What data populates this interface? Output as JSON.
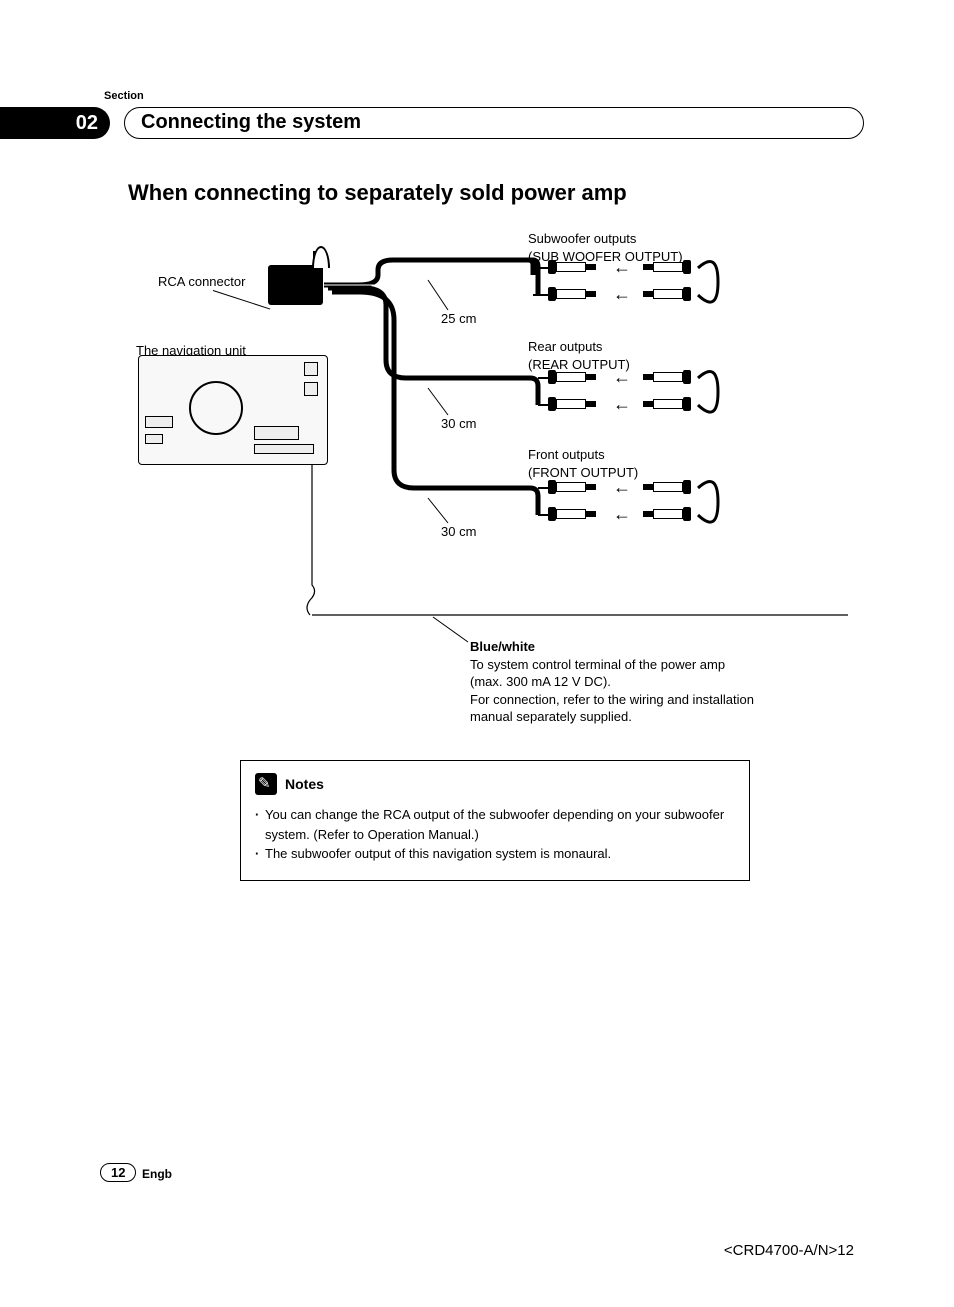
{
  "header": {
    "section_label": "Section",
    "section_number": "02",
    "chapter_title": "Connecting the system"
  },
  "main_title": "When connecting to separately sold power amp",
  "diagram": {
    "rca_connector_label": "RCA connector",
    "nav_unit_label": "The navigation unit",
    "outputs": {
      "subwoofer": {
        "title": "Subwoofer outputs",
        "subtitle": "(SUB WOOFER OUTPUT)",
        "length": "25 cm"
      },
      "rear": {
        "title": "Rear outputs",
        "subtitle": "(REAR OUTPUT)",
        "length": "30 cm"
      },
      "front": {
        "title": "Front outputs",
        "subtitle": "(FRONT OUTPUT)",
        "length": "30 cm"
      }
    },
    "blue_white": {
      "heading": "Blue/white",
      "line1": "To system control terminal of the power amp",
      "line2": "(max. 300 mA 12 V DC).",
      "line3": "For connection, refer to the wiring and installation",
      "line4": "manual separately supplied."
    }
  },
  "notes": {
    "title": "Notes",
    "items": [
      "You can change the RCA output of the subwoofer depending on your subwoofer system. (Refer to Operation Manual.)",
      "The subwoofer output of this navigation system is monaural."
    ]
  },
  "footer": {
    "page_number": "12",
    "lang": "Engb",
    "doc_code": "<CRD4700-A/N>12"
  }
}
